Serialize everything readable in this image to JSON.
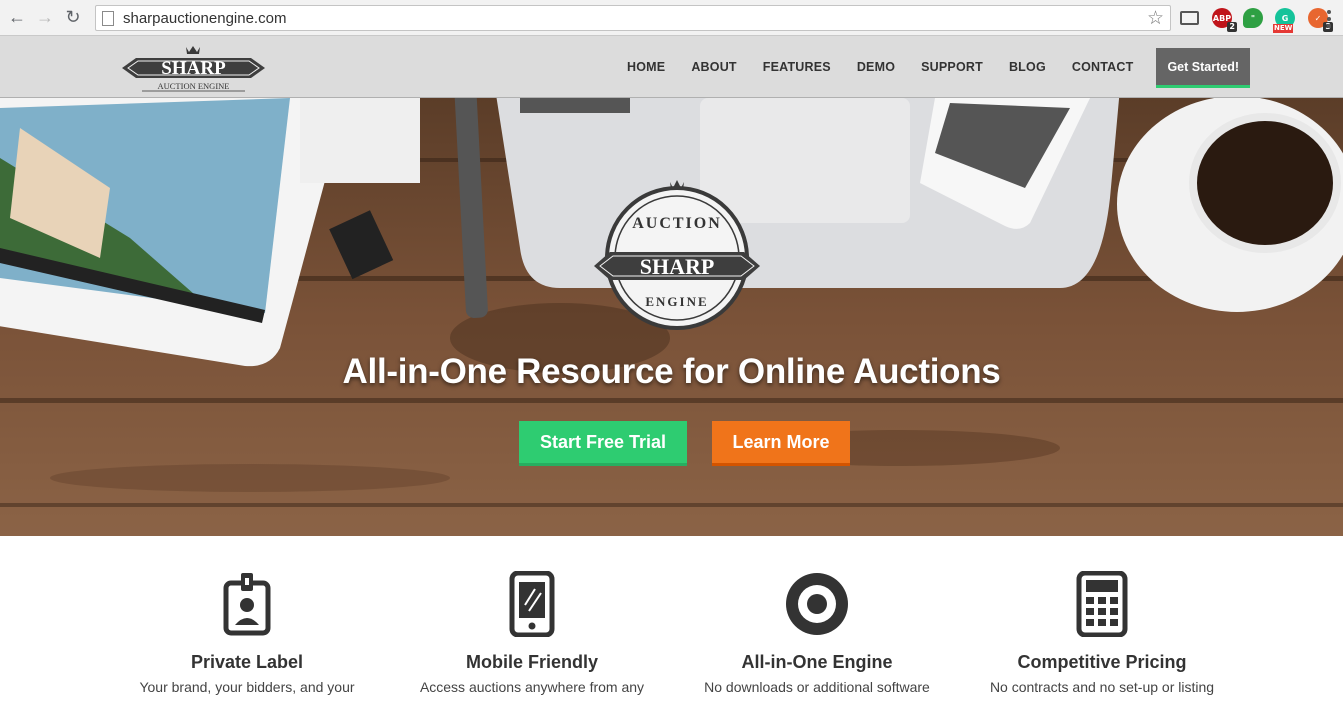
{
  "browser": {
    "url": "sharpauctionengine.com",
    "extensions": [
      {
        "name": "adblock-plus",
        "label": "ABP",
        "badge": "2",
        "color": "#c0141a"
      },
      {
        "name": "hangouts",
        "label": "",
        "badge": "",
        "color": "#2ea043"
      },
      {
        "name": "grammarly",
        "label": "",
        "badge": "NEW",
        "color": "#15c39a"
      },
      {
        "name": "todoist",
        "label": "",
        "badge": "3",
        "color": "#e8662f"
      }
    ]
  },
  "site": {
    "logo_text": "SHARP",
    "logo_sub": "AUCTION ENGINE",
    "nav": [
      "HOME",
      "ABOUT",
      "FEATURES",
      "DEMO",
      "SUPPORT",
      "BLOG",
      "CONTACT"
    ],
    "cta": "Get Started!"
  },
  "hero": {
    "emblem_top": "AUCTION",
    "emblem_mid": "SHARP",
    "emblem_bottom": "ENGINE",
    "title": "All-in-One Resource for Online Auctions",
    "trial_label": "Start Free Trial",
    "learn_label": "Learn More"
  },
  "features": [
    {
      "title": "Private Label",
      "desc": "Your brand, your bidders, and your",
      "icon": "id-badge-icon"
    },
    {
      "title": "Mobile Friendly",
      "desc": "Access auctions anywhere from any",
      "icon": "mobile-phone-icon"
    },
    {
      "title": "All-in-One Engine",
      "desc": "No downloads or additional software",
      "icon": "target-icon"
    },
    {
      "title": "Competitive Pricing",
      "desc": "No contracts and no set-up or listing",
      "icon": "calculator-icon"
    }
  ],
  "colors": {
    "accent_green": "#2ecc71",
    "accent_orange": "#f0741a",
    "header_gray": "#dcdcdc",
    "cta_gray": "#656565"
  }
}
